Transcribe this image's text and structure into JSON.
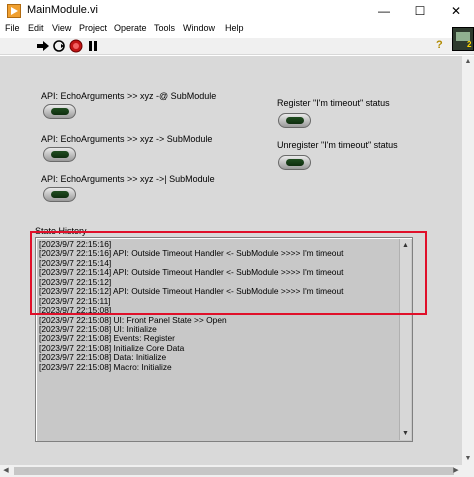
{
  "window": {
    "title": "MainModule.vi",
    "minimize_glyph": "—",
    "maximize_glyph": "☐",
    "close_glyph": "✕"
  },
  "menu": [
    "File",
    "Edit",
    "View",
    "Project",
    "Operate",
    "Tools",
    "Window",
    "Help"
  ],
  "toolbar": {
    "icons": [
      "run-arrow-icon",
      "run-continuously-icon",
      "abort-icon",
      "pause-icon",
      "help-icon"
    ],
    "help_glyph": "?"
  },
  "vi_icon": {
    "number": "2"
  },
  "controls": [
    {
      "label": "API: EchoArguments >> xyz -@ SubModule"
    },
    {
      "label": "API: EchoArguments >> xyz -> SubModule"
    },
    {
      "label": "API: EchoArguments >> xyz ->| SubModule"
    }
  ],
  "status_indicators": [
    {
      "label": "Register \"I'm timeout\" status"
    },
    {
      "label": "Unregister \"I'm timeout\" status"
    }
  ],
  "state_history": {
    "label": "State History",
    "lines": [
      "[2023/9/7 22:15:16]",
      "[2023/9/7 22:15:16] API: Outside Timeout Handler <- SubModule >>>> I'm timeout",
      "[2023/9/7 22:15:14]",
      "[2023/9/7 22:15:14] API: Outside Timeout Handler <- SubModule >>>> I'm timeout",
      "[2023/9/7 22:15:12]",
      "[2023/9/7 22:15:12] API: Outside Timeout Handler <- SubModule >>>> I'm timeout",
      "[2023/9/7 22:15:11]",
      "[2023/9/7 22:15:08]",
      "[2023/9/7 22:15:08] UI: Front Panel State >> Open",
      "[2023/9/7 22:15:08] UI: Initialize",
      "[2023/9/7 22:15:08] Events: Register",
      "[2023/9/7 22:15:08] Initialize Core Data",
      "[2023/9/7 22:15:08] Data: Initialize",
      "[2023/9/7 22:15:08] Macro: Initialize"
    ]
  },
  "colors": {
    "panel_bg": "#d9d9d9",
    "highlight": "#e0102a",
    "led_off": "#1f4d1f"
  }
}
